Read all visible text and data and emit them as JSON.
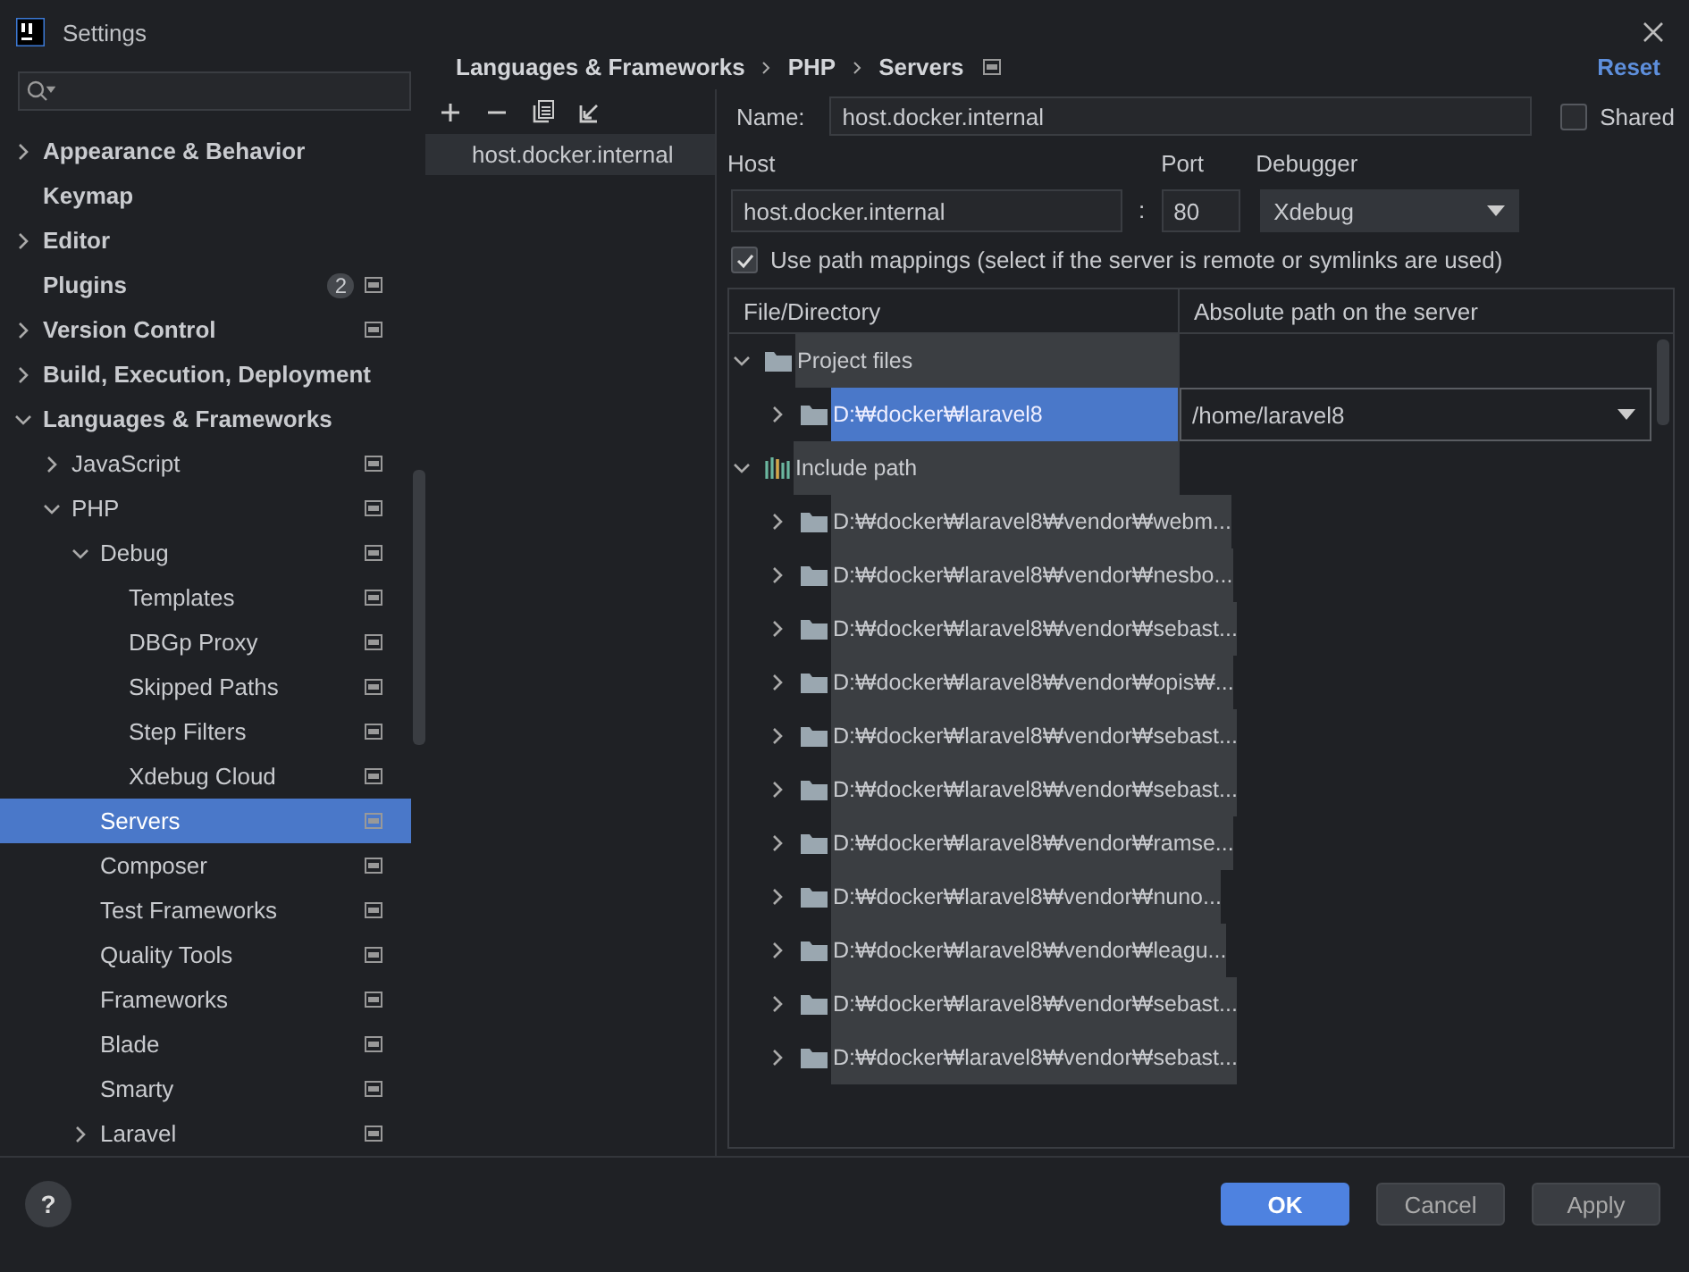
{
  "window": {
    "title": "Settings"
  },
  "sidebar": {
    "items": [
      {
        "label": "Appearance & Behavior",
        "expanded": false,
        "project_icon": false
      },
      {
        "label": "Keymap",
        "project_icon": false
      },
      {
        "label": "Editor",
        "expanded": false,
        "project_icon": false
      },
      {
        "label": "Plugins",
        "badge": "2",
        "project_icon": true
      },
      {
        "label": "Version Control",
        "expanded": false,
        "project_icon": true
      },
      {
        "label": "Build, Execution, Deployment",
        "expanded": false,
        "project_icon": false
      },
      {
        "label": "Languages & Frameworks",
        "expanded": true,
        "project_icon": false,
        "children": [
          {
            "label": "JavaScript",
            "expanded": false,
            "project_icon": true
          },
          {
            "label": "PHP",
            "expanded": true,
            "project_icon": true,
            "children": [
              {
                "label": "Debug",
                "expanded": true,
                "project_icon": true,
                "children": [
                  {
                    "label": "Templates",
                    "project_icon": true
                  },
                  {
                    "label": "DBGp Proxy",
                    "project_icon": true
                  },
                  {
                    "label": "Skipped Paths",
                    "project_icon": true
                  },
                  {
                    "label": "Step Filters",
                    "project_icon": true
                  },
                  {
                    "label": "Xdebug Cloud",
                    "project_icon": true
                  }
                ]
              },
              {
                "label": "Servers",
                "selected": true,
                "project_icon": true
              },
              {
                "label": "Composer",
                "project_icon": true
              },
              {
                "label": "Test Frameworks",
                "project_icon": true
              },
              {
                "label": "Quality Tools",
                "project_icon": true
              },
              {
                "label": "Frameworks",
                "project_icon": true
              },
              {
                "label": "Blade",
                "project_icon": true
              },
              {
                "label": "Smarty",
                "project_icon": true
              },
              {
                "label": "Laravel",
                "expanded": false,
                "project_icon": true
              }
            ]
          }
        ]
      }
    ]
  },
  "breadcrumb": [
    "Languages & Frameworks",
    "PHP",
    "Servers"
  ],
  "reset": "Reset",
  "servers": [
    {
      "name": "host.docker.internal",
      "selected": true
    }
  ],
  "form": {
    "name_label": "Name:",
    "name": "host.docker.internal",
    "shared_label": "Shared",
    "shared": false,
    "host_label": "Host",
    "host": "host.docker.internal",
    "host_port_separator": ":",
    "port_label": "Port",
    "port": "80",
    "debugger_label": "Debugger",
    "debugger": "Xdebug",
    "use_mappings_label": "Use path mappings (select if the server is remote or symlinks are used)",
    "use_mappings": true
  },
  "mappings": {
    "columns": [
      "File/Directory",
      "Absolute path on the server"
    ],
    "rows": [
      {
        "name": "Project files",
        "kind": "folder",
        "expanded": true,
        "children": [
          {
            "name": "D:₩docker₩laravel8",
            "selected": true,
            "expanded": false,
            "server_path": "/home/laravel8"
          }
        ]
      },
      {
        "name": "Include path",
        "kind": "library",
        "expanded": true,
        "children": [
          {
            "name": "D:₩docker₩laravel8₩vendor₩webm...",
            "selected": false,
            "expanded": false
          },
          {
            "name": "D:₩docker₩laravel8₩vendor₩nesbo...",
            "selected": false,
            "expanded": false
          },
          {
            "name": "D:₩docker₩laravel8₩vendor₩sebast...",
            "selected": false,
            "expanded": false
          },
          {
            "name": "D:₩docker₩laravel8₩vendor₩opis₩...",
            "selected": false,
            "expanded": false
          },
          {
            "name": "D:₩docker₩laravel8₩vendor₩sebast...",
            "selected": false,
            "expanded": false
          },
          {
            "name": "D:₩docker₩laravel8₩vendor₩sebast...",
            "selected": false,
            "expanded": false
          },
          {
            "name": "D:₩docker₩laravel8₩vendor₩ramse...",
            "selected": false,
            "expanded": false
          },
          {
            "name": "D:₩docker₩laravel8₩vendor₩nuno...",
            "selected": false,
            "expanded": false
          },
          {
            "name": "D:₩docker₩laravel8₩vendor₩leagu...",
            "selected": false,
            "expanded": false
          },
          {
            "name": "D:₩docker₩laravel8₩vendor₩sebast...",
            "selected": false,
            "expanded": false
          },
          {
            "name": "D:₩docker₩laravel8₩vendor₩sebast...",
            "selected": false,
            "expanded": false
          }
        ]
      }
    ]
  },
  "buttons": [
    {
      "label": "OK",
      "kind": "primary"
    },
    {
      "label": "Cancel",
      "kind": "normal"
    },
    {
      "label": "Apply",
      "kind": "normal"
    }
  ],
  "help": "?"
}
